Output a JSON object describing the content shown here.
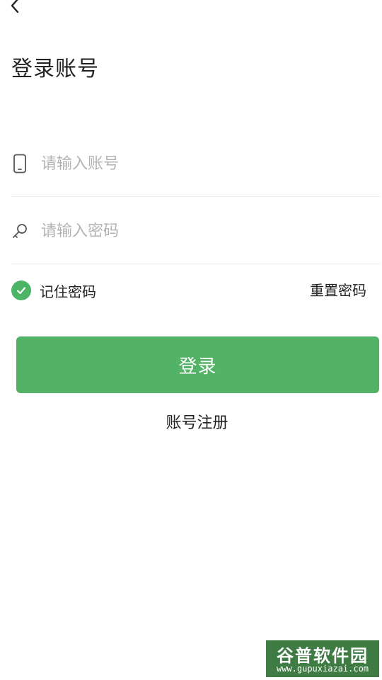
{
  "header": {
    "back_icon": "chevron-left-icon",
    "title": "登录账号"
  },
  "form": {
    "account": {
      "icon": "phone-icon",
      "placeholder": "请输入账号",
      "value": ""
    },
    "password": {
      "icon": "key-icon",
      "placeholder": "请输入密码",
      "value": ""
    }
  },
  "options": {
    "remember_label": "记住密码",
    "remember_checked": true,
    "reset_label": "重置密码"
  },
  "actions": {
    "login_label": "登录",
    "register_label": "账号注册"
  },
  "watermark": {
    "title": "谷普软件园",
    "url": "www.gupuxiazai.com"
  },
  "colors": {
    "accent": "#52b265",
    "text": "#222222",
    "placeholder": "#b3b3b3",
    "divider": "#eeeeee"
  }
}
